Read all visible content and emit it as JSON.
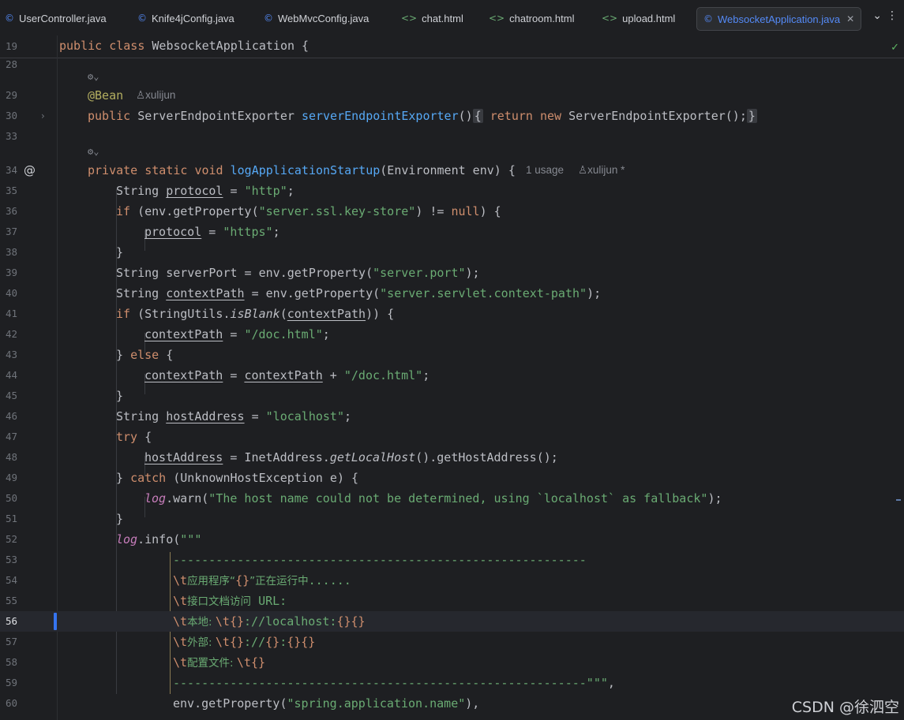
{
  "tabs": [
    {
      "label": "UserController.java",
      "icon": "java-class-icon"
    },
    {
      "label": "Knife4jConfig.java",
      "icon": "java-class-icon"
    },
    {
      "label": "WebMvcConfig.java",
      "icon": "java-class-icon"
    },
    {
      "label": "chat.html",
      "icon": "html-file-icon"
    },
    {
      "label": "chatroom.html",
      "icon": "html-file-icon"
    },
    {
      "label": "upload.html",
      "icon": "html-file-icon"
    },
    {
      "label": "WebsocketApplication.java",
      "icon": "java-class-icon",
      "active": true
    }
  ],
  "sticky": {
    "line": "19",
    "code": "public class WebsocketApplication {"
  },
  "lines": {
    "l28": "28",
    "l29": "29",
    "l30": "30",
    "l33": "33",
    "l34": "34",
    "l35": "35",
    "l36": "36",
    "l37": "37",
    "l38": "38",
    "l39": "39",
    "l40": "40",
    "l41": "41",
    "l42": "42",
    "l43": "43",
    "l44": "44",
    "l45": "45",
    "l46": "46",
    "l47": "47",
    "l48": "48",
    "l49": "49",
    "l50": "50",
    "l51": "51",
    "l52": "52",
    "l53": "53",
    "l54": "54",
    "l55": "55",
    "l56": "56",
    "l57": "57",
    "l58": "58",
    "l59": "59",
    "l60": "60"
  },
  "hints": {
    "author1": "xulijun",
    "usage": "1 usage",
    "author2": "xulijun *"
  },
  "code": {
    "bean": "@Bean",
    "public": "public ",
    "exporter_type": "ServerEndpointExporter ",
    "exporter_fn": "serverEndpointExporter",
    "exporter_parens": "()",
    "exporter_open": "{",
    "return": " return new ",
    "exporter_body": "ServerEndpointExporter();",
    "exporter_close": "}",
    "private_static_void": "private static void ",
    "log_fn": "logApplicationStartup",
    "log_params": "(Environment env) {",
    "l35_a": "String ",
    "l35_var": "protocol",
    "l35_b": " = ",
    "l35_str": "\"http\"",
    "l35_c": ";",
    "l36_if": "if",
    "l36_a": " (env.getProperty(",
    "l36_str": "\"server.ssl.key-store\"",
    "l36_b": ") != ",
    "l36_null": "null",
    "l36_c": ") {",
    "l37_var": "protocol",
    "l37_a": " = ",
    "l37_str": "\"https\"",
    "l37_b": ";",
    "l38": "}",
    "l39_a": "String serverPort = env.getProperty(",
    "l39_str": "\"server.port\"",
    "l39_b": ");",
    "l40_a": "String ",
    "l40_var": "contextPath",
    "l40_b": " = env.getProperty(",
    "l40_str": "\"server.servlet.context-path\"",
    "l40_c": ");",
    "l41_if": "if",
    "l41_a": " (StringUtils.",
    "l41_fn": "isBlank",
    "l41_b": "(",
    "l41_var": "contextPath",
    "l41_c": ")) {",
    "l42_var": "contextPath",
    "l42_a": " = ",
    "l42_str": "\"/doc.html\"",
    "l42_b": ";",
    "l43_a": "} ",
    "l43_else": "else",
    "l43_b": " {",
    "l44_var": "contextPath",
    "l44_a": " = ",
    "l44_var2": "contextPath",
    "l44_b": " + ",
    "l44_str": "\"/doc.html\"",
    "l44_c": ";",
    "l45": "}",
    "l46_a": "String ",
    "l46_var": "hostAddress",
    "l46_b": " = ",
    "l46_str": "\"localhost\"",
    "l46_c": ";",
    "l47_try": "try",
    "l47_a": " {",
    "l48_var": "hostAddress",
    "l48_a": " = InetAddress.",
    "l48_fn": "getLocalHost",
    "l48_b": "().getHostAddress();",
    "l49_a": "} ",
    "l49_catch": "catch",
    "l49_b": " (UnknownHostException e) {",
    "l50_log": "log",
    "l50_a": ".warn(",
    "l50_str": "\"The host name could not be determined, using `localhost` as fallback\"",
    "l50_b": ");",
    "l51": "}",
    "l52_log": "log",
    "l52_a": ".info(",
    "l52_str": "\"\"\"",
    "l53_str": "----------------------------------------------------------",
    "l54_esc": "\\t",
    "l54_cn1": "应用程序“",
    "l54_br": "{}",
    "l54_cn2": "”正在运行中",
    "l54_dots": "......",
    "l55_esc": "\\t",
    "l55_cn": "接口文档访问",
    "l55_str": " URL:",
    "l56_esc": "\\t",
    "l56_cn": "本地: ",
    "l56_esc2": "\\t",
    "l56_br1": "{}",
    "l56_str": "://localhost:",
    "l56_br2": "{}{}",
    "l57_esc": "\\t",
    "l57_cn": "外部: ",
    "l57_esc2": "\\t",
    "l57_br1": "{}",
    "l57_str1": "://",
    "l57_br2": "{}",
    "l57_str2": ":",
    "l57_br3": "{}{}",
    "l58_esc": "\\t",
    "l58_cn": "配置文件: ",
    "l58_esc2": "\\t",
    "l58_br": "{}",
    "l59_str": "----------------------------------------------------------\"\"\"",
    "l59_a": ",",
    "l60_a": "env.getProperty(",
    "l60_str": "\"spring.application.name\"",
    "l60_b": "),"
  },
  "watermark": "CSDN @徐泗空"
}
